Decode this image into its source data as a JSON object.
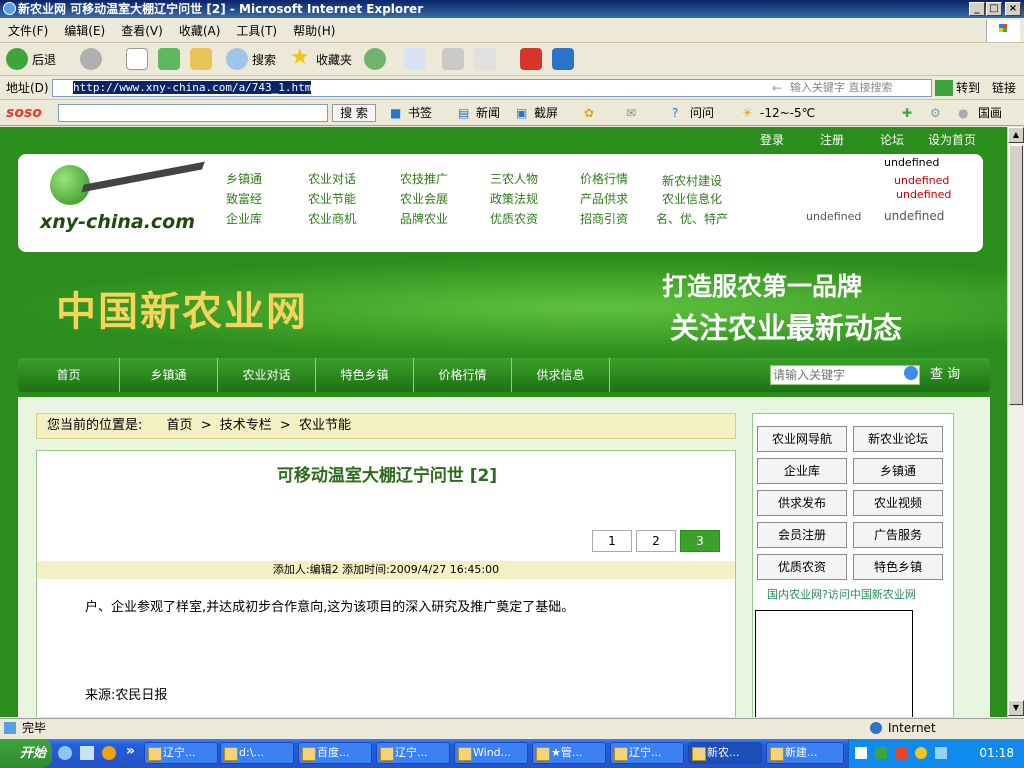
{
  "window": {
    "title": "新农业网 可移动温室大棚辽宁问世 [2] - Microsoft Internet Explorer",
    "min": "_",
    "max": "□",
    "close": "×"
  },
  "menu": [
    "文件(F)",
    "编辑(E)",
    "查看(V)",
    "收藏(A)",
    "工具(T)",
    "帮助(H)"
  ],
  "toolbar": {
    "back": "后退",
    "search": "搜索",
    "favorites": "收藏夹"
  },
  "address": {
    "label": "地址(D)",
    "url": "http://www.xny-china.com/a/743_1.htm",
    "search_hint": "输入关键字 直接搜索",
    "go": "转到",
    "links": "链接"
  },
  "soso": {
    "logo": "soso",
    "search_btn": "搜 索",
    "bookmark": "书签",
    "news": "新闻",
    "screenshot": "截屏",
    "ask": "问问",
    "weather": "-12~-5℃",
    "portal": "国画"
  },
  "site": {
    "toplinks": [
      "登录",
      "注册",
      "论坛",
      "设为首页"
    ],
    "logo_text": "xny-china.com",
    "nav_rows": [
      [
        "乡镇通",
        "农业对话",
        "农技推广",
        "三农人物",
        "价格行情",
        "新农村建设"
      ],
      [
        "致富经",
        "农业节能",
        "农业会展",
        "政策法规",
        "产品供求",
        "农业信息化"
      ],
      [
        "企业库",
        "农业商机",
        "品牌农业",
        "优质农资",
        "招商引资",
        "名、优、特产"
      ]
    ],
    "undefined_1": "undefined",
    "undefined_2": "undefined",
    "undefined_3": "undefined",
    "undefined_4": "undefined",
    "undefined_5": "undefined",
    "banner_title": "中国新农业网",
    "banner_slogan1": "打造服农第一品牌",
    "banner_slogan2": "关注农业最新动态",
    "mainnav": [
      "首页",
      "乡镇通",
      "农业对话",
      "特色乡镇",
      "价格行情",
      "供求信息"
    ],
    "search_placeholder": "请输入关键字",
    "search_btn": "查 询",
    "breadcrumb_label": "您当前的位置是:",
    "breadcrumb": [
      "首页",
      "技术专栏",
      "农业节能"
    ],
    "breadcrumb_sep": ">",
    "article_title": "可移动温室大棚辽宁问世 [2]",
    "pages": [
      "1",
      "2",
      "3"
    ],
    "meta": "添加人:编辑2 添加时间:2009/4/27 16:45:00",
    "body": "户、企业参观了样室,并达成初步合作意向,这为该项目的深入研究及推广奠定了基础。",
    "source": "来源:农民日报",
    "sidebar_buttons": [
      [
        "农业网导航",
        "新农业论坛"
      ],
      [
        "企业库",
        "乡镇通"
      ],
      [
        "供求发布",
        "农业视频"
      ],
      [
        "会员注册",
        "广告服务"
      ],
      [
        "优质农资",
        "特色乡镇"
      ]
    ],
    "sidebar_link": "国内农业网?访问中国新农业网"
  },
  "status": {
    "text": "完毕",
    "zone": "Internet"
  },
  "taskbar": {
    "start": "开始",
    "tasks": [
      "辽宁...",
      "d:\\...",
      "百度...",
      "辽宁...",
      "Wind...",
      "★管...",
      "辽宁...",
      "新农...",
      "新建..."
    ],
    "clock": "01:18"
  }
}
